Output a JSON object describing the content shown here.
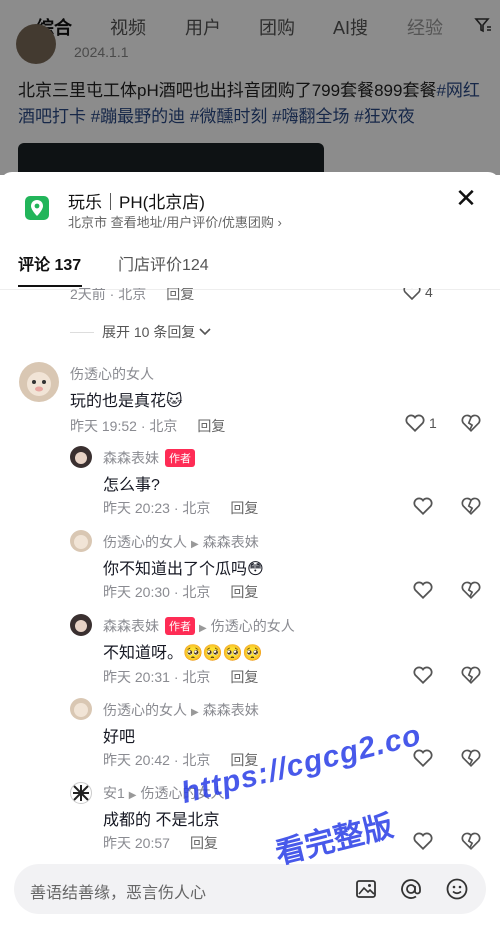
{
  "top_tabs": [
    "综合",
    "视频",
    "用户",
    "团购",
    "AI搜",
    "经验"
  ],
  "post": {
    "date": "2024.1.1",
    "text": "北京三里屯工体pH酒吧也出抖音团购了799套餐899套餐",
    "tags": "#网红酒吧打卡 #蹦最野的迪 #微醺时刻 #嗨翻全场 #狂欢夜"
  },
  "shop": {
    "name": "玩乐｜PH(北京店)",
    "subtitle": "北京市 查看地址/用户评价/优惠团购 ›"
  },
  "comment_tabs": [
    {
      "label": "评论 137"
    },
    {
      "label": "门店评价124"
    }
  ],
  "partial_row": {
    "meta": "2天前 · 北京",
    "reply": "回复",
    "likes": "4"
  },
  "expand_label": "展开 10 条回复",
  "comments": [
    {
      "user": "伤透心的女人",
      "text": "玩的也是真花🐱",
      "time": "昨天 19:52 · 北京",
      "reply": "回复",
      "likes": "1"
    },
    {
      "user": "森森表妹",
      "badge": "作者",
      "text": "怎么事?",
      "time": "昨天 20:23 · 北京",
      "reply": "回复"
    },
    {
      "user": "伤透心的女人",
      "to": "森森表妹",
      "text": "你不知道出了个瓜吗😳",
      "time": "昨天 20:30 · 北京",
      "reply": "回复"
    },
    {
      "user": "森森表妹",
      "badge": "作者",
      "to": "伤透心的女人",
      "text": "不知道呀。🥺🥺🥺🥺",
      "time": "昨天 20:31 · 北京",
      "reply": "回复"
    },
    {
      "user": "伤透心的女人",
      "to": "森森表妹",
      "text": "好吧",
      "time": "昨天 20:42 · 北京",
      "reply": "回复"
    },
    {
      "user": "安1",
      "to": "伤透心的女人",
      "text": "成都的 不是北京",
      "time": "昨天 20:57",
      "reply": "回复"
    }
  ],
  "input": {
    "placeholder": "善语结善缘，恶言伤人心"
  },
  "watermark": {
    "line1": "https://cgcg2.co",
    "line2": "看完整版"
  },
  "colors": {
    "accent": "#fe2c55",
    "shop_green": "#22b55a",
    "tag_blue": "#2b4a86",
    "watermark": "#283ce6"
  },
  "icons": [
    "filter-icon",
    "location-pin-icon",
    "close-icon",
    "chevron-down-icon",
    "heart-icon",
    "dislike-heart-icon",
    "image-icon",
    "at-icon",
    "emoji-icon"
  ]
}
